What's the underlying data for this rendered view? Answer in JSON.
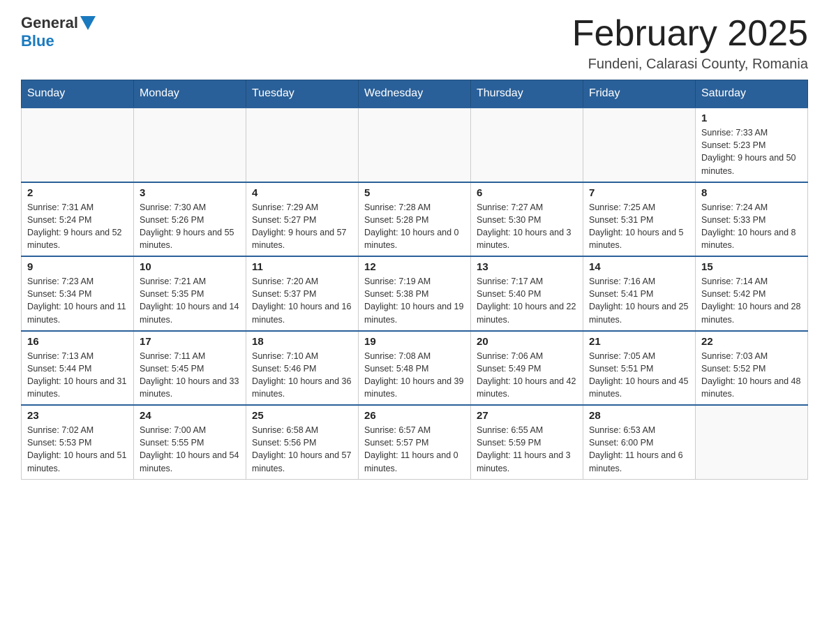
{
  "header": {
    "month_year": "February 2025",
    "location": "Fundeni, Calarasi County, Romania",
    "logo_general": "General",
    "logo_blue": "Blue"
  },
  "weekdays": [
    "Sunday",
    "Monday",
    "Tuesday",
    "Wednesday",
    "Thursday",
    "Friday",
    "Saturday"
  ],
  "weeks": [
    [
      {
        "day": "",
        "info": ""
      },
      {
        "day": "",
        "info": ""
      },
      {
        "day": "",
        "info": ""
      },
      {
        "day": "",
        "info": ""
      },
      {
        "day": "",
        "info": ""
      },
      {
        "day": "",
        "info": ""
      },
      {
        "day": "1",
        "info": "Sunrise: 7:33 AM\nSunset: 5:23 PM\nDaylight: 9 hours and 50 minutes."
      }
    ],
    [
      {
        "day": "2",
        "info": "Sunrise: 7:31 AM\nSunset: 5:24 PM\nDaylight: 9 hours and 52 minutes."
      },
      {
        "day": "3",
        "info": "Sunrise: 7:30 AM\nSunset: 5:26 PM\nDaylight: 9 hours and 55 minutes."
      },
      {
        "day": "4",
        "info": "Sunrise: 7:29 AM\nSunset: 5:27 PM\nDaylight: 9 hours and 57 minutes."
      },
      {
        "day": "5",
        "info": "Sunrise: 7:28 AM\nSunset: 5:28 PM\nDaylight: 10 hours and 0 minutes."
      },
      {
        "day": "6",
        "info": "Sunrise: 7:27 AM\nSunset: 5:30 PM\nDaylight: 10 hours and 3 minutes."
      },
      {
        "day": "7",
        "info": "Sunrise: 7:25 AM\nSunset: 5:31 PM\nDaylight: 10 hours and 5 minutes."
      },
      {
        "day": "8",
        "info": "Sunrise: 7:24 AM\nSunset: 5:33 PM\nDaylight: 10 hours and 8 minutes."
      }
    ],
    [
      {
        "day": "9",
        "info": "Sunrise: 7:23 AM\nSunset: 5:34 PM\nDaylight: 10 hours and 11 minutes."
      },
      {
        "day": "10",
        "info": "Sunrise: 7:21 AM\nSunset: 5:35 PM\nDaylight: 10 hours and 14 minutes."
      },
      {
        "day": "11",
        "info": "Sunrise: 7:20 AM\nSunset: 5:37 PM\nDaylight: 10 hours and 16 minutes."
      },
      {
        "day": "12",
        "info": "Sunrise: 7:19 AM\nSunset: 5:38 PM\nDaylight: 10 hours and 19 minutes."
      },
      {
        "day": "13",
        "info": "Sunrise: 7:17 AM\nSunset: 5:40 PM\nDaylight: 10 hours and 22 minutes."
      },
      {
        "day": "14",
        "info": "Sunrise: 7:16 AM\nSunset: 5:41 PM\nDaylight: 10 hours and 25 minutes."
      },
      {
        "day": "15",
        "info": "Sunrise: 7:14 AM\nSunset: 5:42 PM\nDaylight: 10 hours and 28 minutes."
      }
    ],
    [
      {
        "day": "16",
        "info": "Sunrise: 7:13 AM\nSunset: 5:44 PM\nDaylight: 10 hours and 31 minutes."
      },
      {
        "day": "17",
        "info": "Sunrise: 7:11 AM\nSunset: 5:45 PM\nDaylight: 10 hours and 33 minutes."
      },
      {
        "day": "18",
        "info": "Sunrise: 7:10 AM\nSunset: 5:46 PM\nDaylight: 10 hours and 36 minutes."
      },
      {
        "day": "19",
        "info": "Sunrise: 7:08 AM\nSunset: 5:48 PM\nDaylight: 10 hours and 39 minutes."
      },
      {
        "day": "20",
        "info": "Sunrise: 7:06 AM\nSunset: 5:49 PM\nDaylight: 10 hours and 42 minutes."
      },
      {
        "day": "21",
        "info": "Sunrise: 7:05 AM\nSunset: 5:51 PM\nDaylight: 10 hours and 45 minutes."
      },
      {
        "day": "22",
        "info": "Sunrise: 7:03 AM\nSunset: 5:52 PM\nDaylight: 10 hours and 48 minutes."
      }
    ],
    [
      {
        "day": "23",
        "info": "Sunrise: 7:02 AM\nSunset: 5:53 PM\nDaylight: 10 hours and 51 minutes."
      },
      {
        "day": "24",
        "info": "Sunrise: 7:00 AM\nSunset: 5:55 PM\nDaylight: 10 hours and 54 minutes."
      },
      {
        "day": "25",
        "info": "Sunrise: 6:58 AM\nSunset: 5:56 PM\nDaylight: 10 hours and 57 minutes."
      },
      {
        "day": "26",
        "info": "Sunrise: 6:57 AM\nSunset: 5:57 PM\nDaylight: 11 hours and 0 minutes."
      },
      {
        "day": "27",
        "info": "Sunrise: 6:55 AM\nSunset: 5:59 PM\nDaylight: 11 hours and 3 minutes."
      },
      {
        "day": "28",
        "info": "Sunrise: 6:53 AM\nSunset: 6:00 PM\nDaylight: 11 hours and 6 minutes."
      },
      {
        "day": "",
        "info": ""
      }
    ]
  ]
}
